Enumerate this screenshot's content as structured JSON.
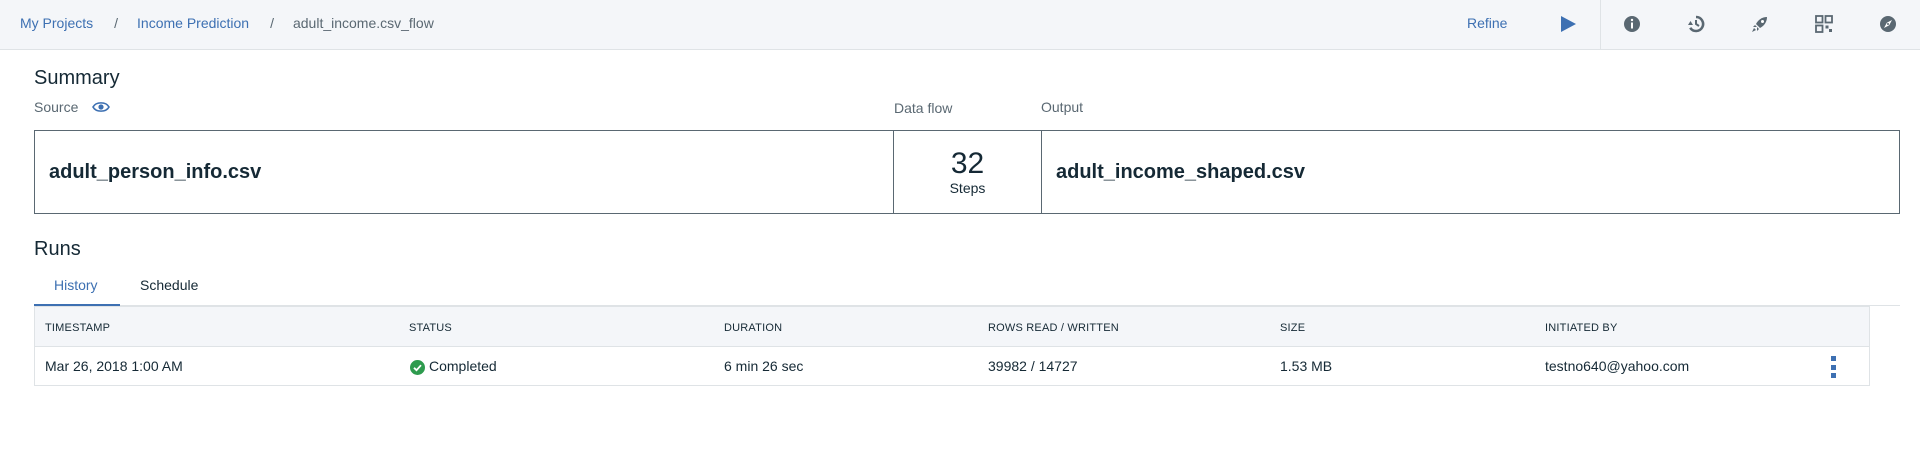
{
  "breadcrumb": {
    "items": [
      "My Projects",
      "Income Prediction"
    ],
    "separator": "/",
    "current": "adult_income.csv_flow"
  },
  "toolbar": {
    "refine_label": "Refine",
    "icons": [
      "play-icon",
      "info-icon",
      "history-icon",
      "rocket-icon",
      "settings-grid-icon",
      "compass-icon"
    ]
  },
  "summary": {
    "title": "Summary",
    "source_label": "Source",
    "data_flow_label": "Data flow",
    "output_label": "Output",
    "source_file": "adult_person_info.csv",
    "steps_count": "32",
    "steps_label": "Steps",
    "output_file": "adult_income_shaped.csv"
  },
  "runs": {
    "title": "Runs",
    "tabs": [
      {
        "label": "History",
        "active": true
      },
      {
        "label": "Schedule",
        "active": false
      }
    ],
    "columns": [
      "TIMESTAMP",
      "STATUS",
      "DURATION",
      "ROWS READ / WRITTEN",
      "SIZE",
      "INITIATED BY"
    ],
    "rows": [
      {
        "timestamp": "Mar 26, 2018 1:00 AM",
        "status": "Completed",
        "duration": "6 min 26 sec",
        "rows": "39982 / 14727",
        "size": "1.53 MB",
        "initiated_by": "testno640@yahoo.com"
      }
    ]
  },
  "colors": {
    "accent": "#3d70b2",
    "success": "#2e9b4e",
    "text": "#152935",
    "muted": "#5a6872",
    "header_bg": "#f4f6f9",
    "border": "#dfe3e6"
  }
}
